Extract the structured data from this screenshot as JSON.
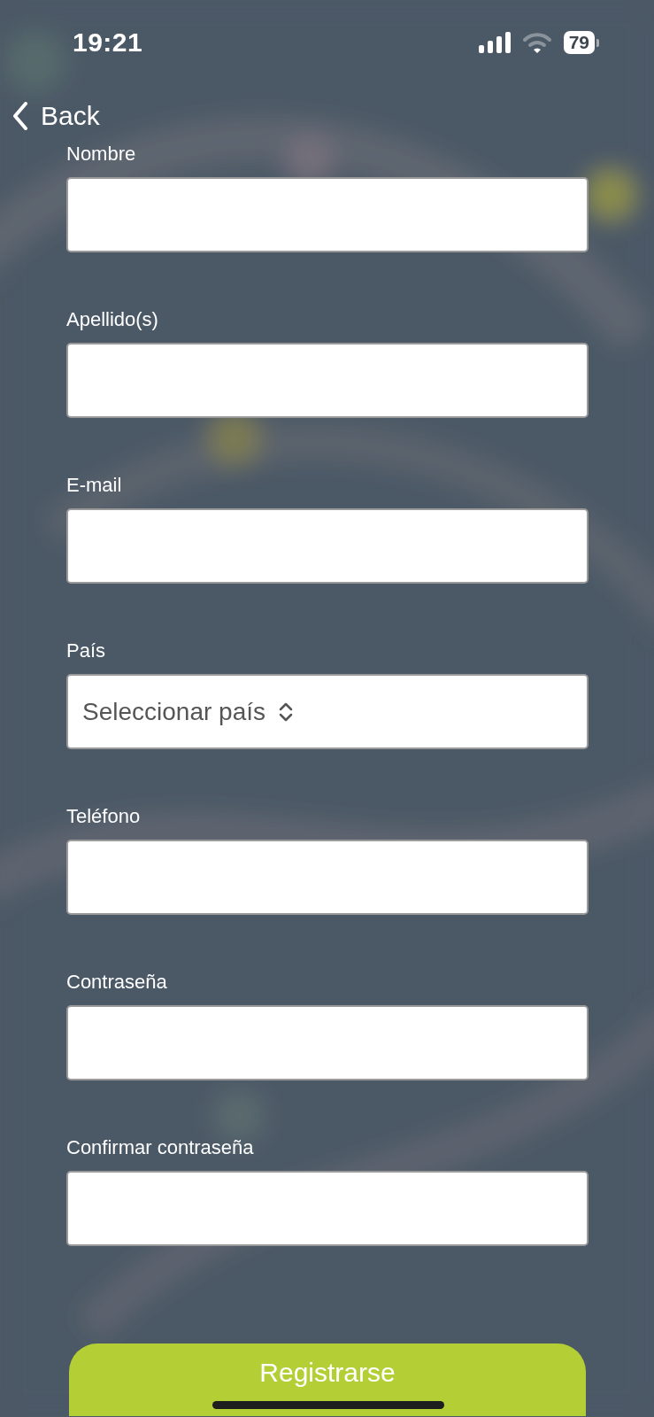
{
  "status_bar": {
    "time": "19:21",
    "battery": "79"
  },
  "nav": {
    "back_label": "Back"
  },
  "fields": [
    {
      "kind": "text",
      "label": "Nombre"
    },
    {
      "kind": "text",
      "label": "Apellido(s)"
    },
    {
      "kind": "text",
      "label": "E-mail"
    },
    {
      "kind": "select",
      "label": "País",
      "placeholder": "Seleccionar país"
    },
    {
      "kind": "text",
      "label": "Teléfono"
    },
    {
      "kind": "text",
      "label": "Contraseña"
    },
    {
      "kind": "text",
      "label": "Confirmar contraseña"
    }
  ],
  "submit_button": "Registrarse"
}
